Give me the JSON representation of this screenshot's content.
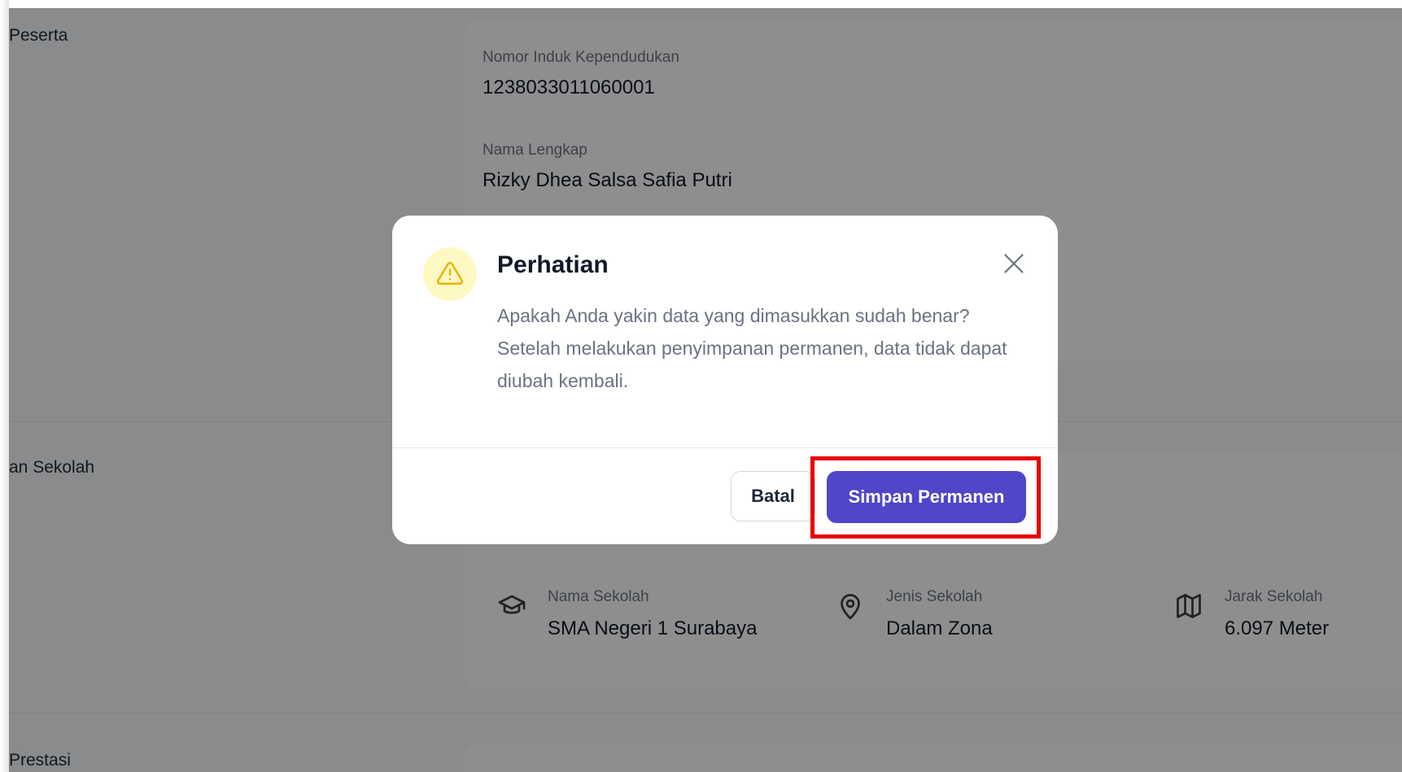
{
  "page": {
    "sections": {
      "peserta": {
        "label": "Peserta",
        "fields": [
          {
            "label": "Nomor Induk Kependudukan",
            "value": "1238033011060001"
          },
          {
            "label": "Nama Lengkap",
            "value": "Rizky Dhea Salsa Safia Putri"
          }
        ]
      },
      "sekolah": {
        "label": "an Sekolah",
        "items": [
          {
            "icon": "graduation-cap-icon",
            "label": "Nama Sekolah",
            "value": "SMA Negeri 1 Surabaya"
          },
          {
            "icon": "map-pin-icon",
            "label": "Jenis Sekolah",
            "value": "Dalam Zona"
          },
          {
            "icon": "map-icon",
            "label": "Jarak Sekolah",
            "value": "6.097 Meter"
          }
        ]
      },
      "prestasi": {
        "label": "Prestasi"
      }
    }
  },
  "modal": {
    "icon": "warning-icon",
    "title": "Perhatian",
    "message": "Apakah Anda yakin data yang dimasukkan sudah benar? Setelah melakukan penyimpanan permanen, data tidak dapat diubah kembali.",
    "cancel_label": "Batal",
    "confirm_label": "Simpan Permanen"
  },
  "colors": {
    "primary": "#4f46c8",
    "warning_bg": "#fef9c3",
    "warning_icon": "#eab308",
    "highlight": "#e60000"
  }
}
